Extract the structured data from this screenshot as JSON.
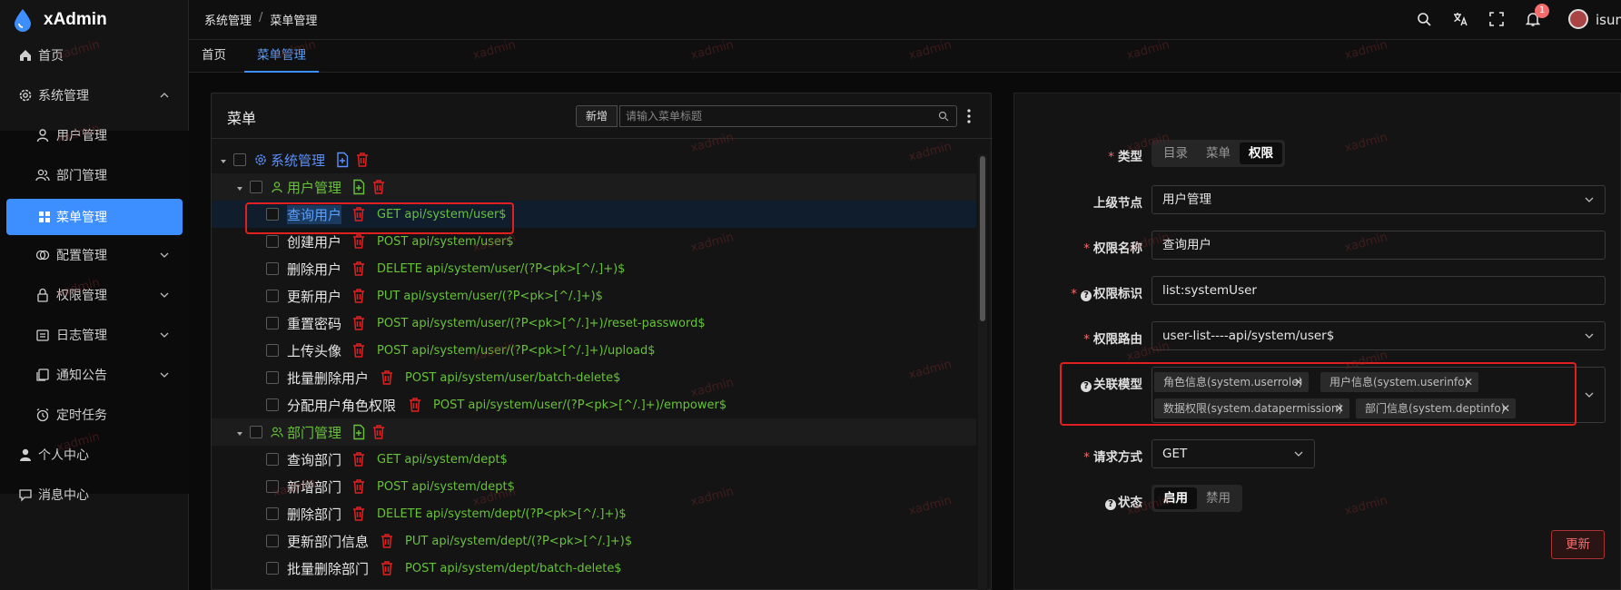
{
  "app": {
    "name": "xAdmin"
  },
  "sidebar": {
    "items": [
      {
        "label": "首页",
        "icon": "home-icon"
      },
      {
        "label": "系统管理",
        "icon": "gear-icon",
        "expanded": true
      },
      {
        "label": "用户管理",
        "icon": "user-icon"
      },
      {
        "label": "部门管理",
        "icon": "users-icon"
      },
      {
        "label": "菜单管理",
        "icon": "grid-icon",
        "active": true
      },
      {
        "label": "配置管理",
        "icon": "config-icon"
      },
      {
        "label": "权限管理",
        "icon": "lock-icon"
      },
      {
        "label": "日志管理",
        "icon": "log-icon"
      },
      {
        "label": "通知公告",
        "icon": "notice-icon"
      },
      {
        "label": "定时任务",
        "icon": "alarm-icon"
      },
      {
        "label": "个人中心",
        "icon": "person-icon"
      },
      {
        "label": "消息中心",
        "icon": "message-icon"
      }
    ]
  },
  "header": {
    "breadcrumb": [
      "系统管理",
      "菜单管理"
    ],
    "breadcrumb_sep": "/",
    "notification_count": "1",
    "username": "isum"
  },
  "tabs": [
    {
      "label": "首页",
      "active": false
    },
    {
      "label": "菜单管理",
      "active": true
    }
  ],
  "menu_panel": {
    "title": "菜单",
    "add_button": "新增",
    "search_placeholder": "请输入菜单标题",
    "rows": [
      {
        "label": "系统管理",
        "api": "",
        "level": 0,
        "color": "#5b8ff9",
        "icon": "gear-icon"
      },
      {
        "label": "用户管理",
        "api": "",
        "level": 1,
        "color": "#67c23a",
        "icon": "user-icon"
      },
      {
        "label": "查询用户",
        "api": "GET api/system/user$",
        "level": 2,
        "selected": true
      },
      {
        "label": "创建用户",
        "api": "POST api/system/user$",
        "level": 2
      },
      {
        "label": "删除用户",
        "api": "DELETE api/system/user/(?P<pk>[^/.]+)$",
        "level": 2
      },
      {
        "label": "更新用户",
        "api": "PUT api/system/user/(?P<pk>[^/.]+)$",
        "level": 2
      },
      {
        "label": "重置密码",
        "api": "POST api/system/user/(?P<pk>[^/.]+)/reset-password$",
        "level": 2
      },
      {
        "label": "上传头像",
        "api": "POST api/system/user/(?P<pk>[^/.]+)/upload$",
        "level": 2
      },
      {
        "label": "批量删除用户",
        "api": "POST api/system/user/batch-delete$",
        "level": 2
      },
      {
        "label": "分配用户角色权限",
        "api": "POST api/system/user/(?P<pk>[^/.]+)/empower$",
        "level": 2
      },
      {
        "label": "部门管理",
        "api": "",
        "level": 1,
        "color": "#67c23a",
        "icon": "users-icon"
      },
      {
        "label": "查询部门",
        "api": "GET api/system/dept$",
        "level": 2
      },
      {
        "label": "新增部门",
        "api": "POST api/system/dept$",
        "level": 2
      },
      {
        "label": "删除部门",
        "api": "DELETE api/system/dept/(?P<pk>[^/.]+)$",
        "level": 2
      },
      {
        "label": "更新部门信息",
        "api": "PUT api/system/dept/(?P<pk>[^/.]+)$",
        "level": 2
      },
      {
        "label": "批量删除部门",
        "api": "POST api/system/dept/batch-delete$",
        "level": 2
      }
    ]
  },
  "form": {
    "type": {
      "label": "类型",
      "options": [
        "目录",
        "菜单",
        "权限"
      ],
      "selected": "权限"
    },
    "parent": {
      "label": "上级节点",
      "value": "用户管理"
    },
    "name": {
      "label": "权限名称",
      "value": "查询用户"
    },
    "code": {
      "label": "权限标识",
      "value": "list:systemUser"
    },
    "route": {
      "label": "权限路由",
      "value": "user-list----api/system/user$"
    },
    "models": {
      "label": "关联模型",
      "chips": [
        "角色信息(system.userrole)",
        "用户信息(system.userinfo)",
        "数据权限(system.datapermission)",
        "部门信息(system.deptinfo)"
      ]
    },
    "method": {
      "label": "请求方式",
      "value": "GET"
    },
    "status": {
      "label": "状态",
      "options": [
        "启用",
        "禁用"
      ],
      "selected": "启用"
    },
    "update_button": "更新"
  },
  "watermark": "xadmin",
  "colors": {
    "accent": "#3d8fff",
    "api_green": "#67c23a",
    "delete_red": "#e02020",
    "highlight_box": "#e02020"
  }
}
